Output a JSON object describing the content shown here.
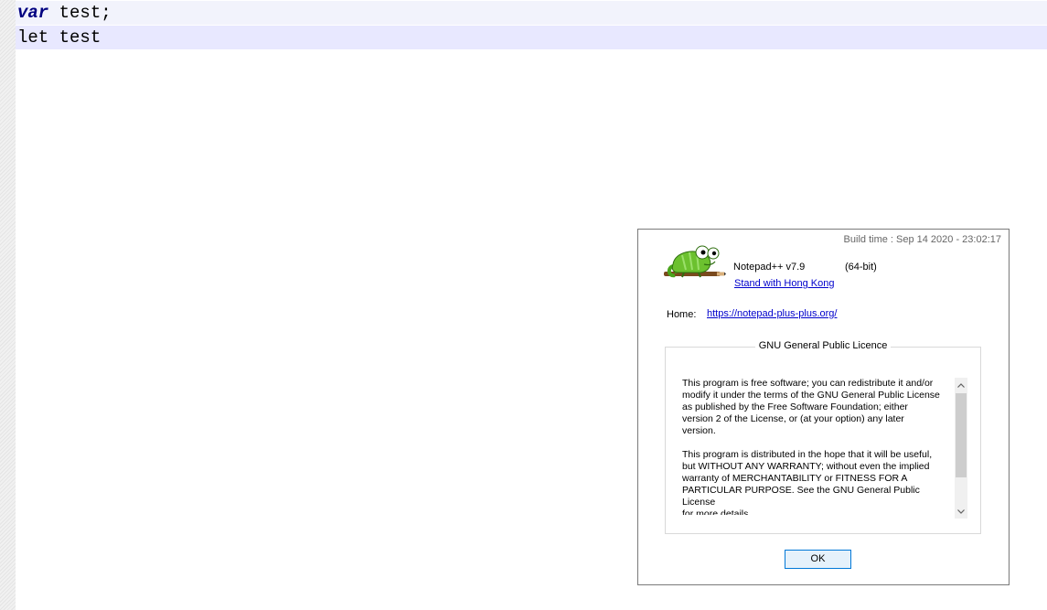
{
  "editor": {
    "lines": [
      {
        "keyword": "var",
        "rest": " test;"
      },
      {
        "text": "let test"
      }
    ]
  },
  "about": {
    "build_time": "Build time : Sep 14 2020 - 23:02:17",
    "app_name": "Notepad++ v7.9",
    "bits": "(64-bit)",
    "stand_link": "Stand with Hong Kong",
    "home_label": "Home:",
    "home_url": "https://notepad-plus-plus.org/",
    "license_title": "GNU General Public Licence",
    "license_paragraphs": [
      "This program is free software; you can redistribute it and/or\nmodify it under the terms of the GNU General Public License\nas published by the Free Software Foundation; either\nversion 2 of the License, or (at your option) any later\nversion.",
      "This program is distributed in the hope that it will be useful,\nbut WITHOUT ANY WARRANTY; without even the implied\nwarranty of MERCHANTABILITY or FITNESS FOR A\nPARTICULAR PURPOSE.  See the GNU General Public License\nfor more details."
    ],
    "ok_label": "OK"
  },
  "icons": {
    "logo": "notepad-plus-plus-chameleon-icon",
    "scroll_up": "chevron-up-icon",
    "scroll_down": "chevron-down-icon"
  },
  "colors": {
    "keyword": "#000080",
    "current_line": "#e8e8ff",
    "link": "#0000cc",
    "button_border": "#0078d7"
  }
}
